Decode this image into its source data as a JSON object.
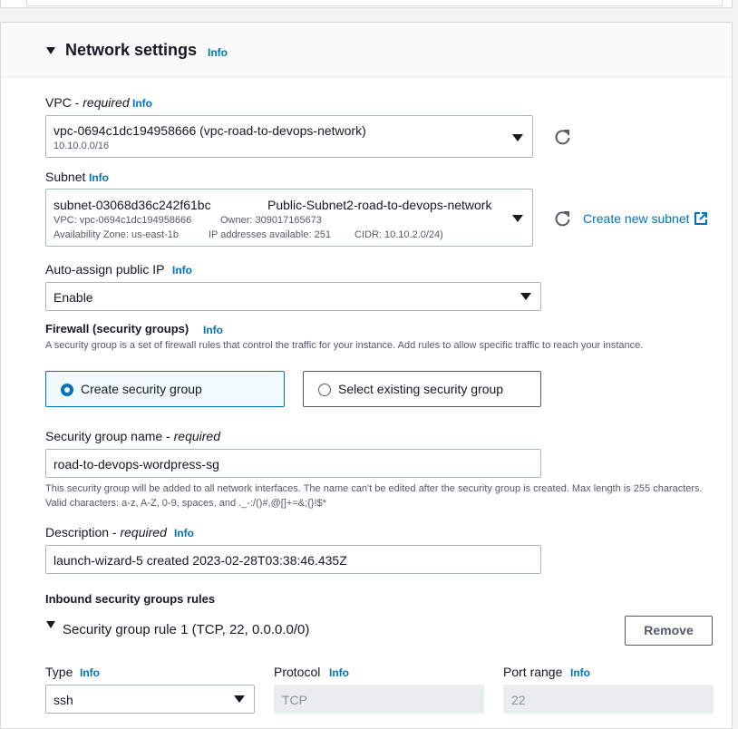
{
  "common": {
    "info": "Info"
  },
  "section": {
    "title": "Network settings"
  },
  "vpc": {
    "label": "VPC",
    "required": "required",
    "value": "vpc-0694c1dc194958666 (vpc-road-to-devops-network)",
    "cidr": "10.10.0.0/16"
  },
  "subnet": {
    "label": "Subnet",
    "id": "subnet-03068d36c242f61bc",
    "name": "Public-Subnet2-road-to-devops-network",
    "vpc_line": "VPC: vpc-0694c1dc194958666",
    "owner_line": "Owner: 309017165673",
    "az_line": "Availability Zone: us-east-1b",
    "ips_line": "IP addresses available: 251",
    "cidr_line": "CIDR: 10.10.2.0/24)",
    "create_link": "Create new subnet"
  },
  "auto_assign": {
    "label": "Auto-assign public IP",
    "value": "Enable"
  },
  "firewall": {
    "label": "Firewall (security groups)",
    "description": "A security group is a set of firewall rules that control the traffic for your instance. Add rules to allow specific traffic to reach your instance.",
    "option_create": "Create security group",
    "option_existing": "Select existing security group"
  },
  "sg_name": {
    "label": "Security group name",
    "required": "required",
    "value": "road-to-devops-wordpress-sg",
    "help": "This security group will be added to all network interfaces. The name can't be edited after the security group is created. Max length is 255 characters. Valid characters: a-z, A-Z, 0-9, spaces, and ._-:/()#,@[]+=&;{}!$*"
  },
  "description": {
    "label": "Description",
    "required": "required",
    "value": "launch-wizard-5 created 2023-02-28T03:38:46.435Z"
  },
  "inbound": {
    "heading": "Inbound security groups rules",
    "rule_title": "Security group rule 1 (TCP, 22, 0.0.0.0/0)",
    "remove_label": "Remove",
    "type_label": "Type",
    "type_value": "ssh",
    "protocol_label": "Protocol",
    "protocol_value": "TCP",
    "port_label": "Port range",
    "port_value": "22"
  },
  "colors": {
    "link": "#0073bb",
    "selected_tile_bg": "#f1faff",
    "selected_tile_border": "#0073bb"
  }
}
